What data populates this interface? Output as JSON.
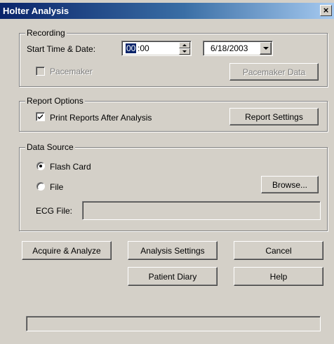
{
  "window": {
    "title": "Holter Analysis",
    "close_glyph": "×"
  },
  "recording": {
    "group_label": "Recording",
    "start_time_label": "Start Time & Date:",
    "time_hours": "00",
    "time_rest": ":00",
    "date_value": "6/18/2003",
    "pacemaker_label": "Pacemaker",
    "pacemaker_checked": false,
    "pacemaker_data_button": "Pacemaker Data"
  },
  "report_options": {
    "group_label": "Report Options",
    "print_reports_label": "Print Reports After Analysis",
    "print_reports_checked": true,
    "report_settings_button": "Report Settings"
  },
  "data_source": {
    "group_label": "Data Source",
    "flash_card_label": "Flash Card",
    "file_label": "File",
    "selected": "Flash Card",
    "browse_button": "Browse...",
    "ecg_file_label": "ECG File:",
    "ecg_file_value": ""
  },
  "buttons": {
    "acquire_analyze": "Acquire & Analyze",
    "analysis_settings": "Analysis Settings",
    "cancel": "Cancel",
    "patient_diary": "Patient Diary",
    "help": "Help"
  },
  "status_bar": {
    "text": ""
  },
  "colors": {
    "face": "#d4d0c8",
    "title_start": "#0a246a",
    "title_end": "#a6caf0",
    "selection": "#0a246a"
  }
}
